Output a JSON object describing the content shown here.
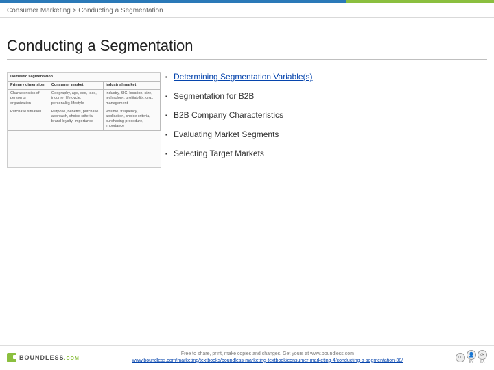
{
  "breadcrumb": "Consumer Marketing > Conducting a Segmentation",
  "title": "Conducting a Segmentation",
  "thumb": {
    "r0c0": "Domestic segmentation",
    "r1c0": "Primary dimension",
    "r1c1": "Consumer market",
    "r1c2": "Industrial market",
    "r2c0": "Characteristics of person or organization",
    "r2c1": "Geography, age, sex, race, income, life cycle, personality, lifestyle",
    "r2c2": "Industry, SIC, location, size, technology, profitability, org., management",
    "r3c0": "Purchase situation",
    "r3c1": "Purpose, benefits, purchase approach, choice criteria, brand loyalty, importance",
    "r3c2": "Volume, frequency, application, choice criteria, purchasing procedure, importance"
  },
  "bullets": [
    "Determining Segmentation Variable(s)",
    "Segmentation for B2B",
    "B2B Company Characteristics",
    "Evaluating Market Segments",
    "Selecting Target Markets"
  ],
  "footer": {
    "tagline": "Free to share, print, make copies and changes. Get yours at www.boundless.com",
    "url": "www.boundless.com/marketing/textbooks/boundless-marketing-textbook/consumer-marketing-4/conducting-a-segmentation-38/",
    "logo": "BOUNDLESS",
    "logo_suffix": ".COM",
    "cc": "cc",
    "by": "BY",
    "sa": "SA",
    "person": "👤",
    "cycle": "⟳"
  }
}
